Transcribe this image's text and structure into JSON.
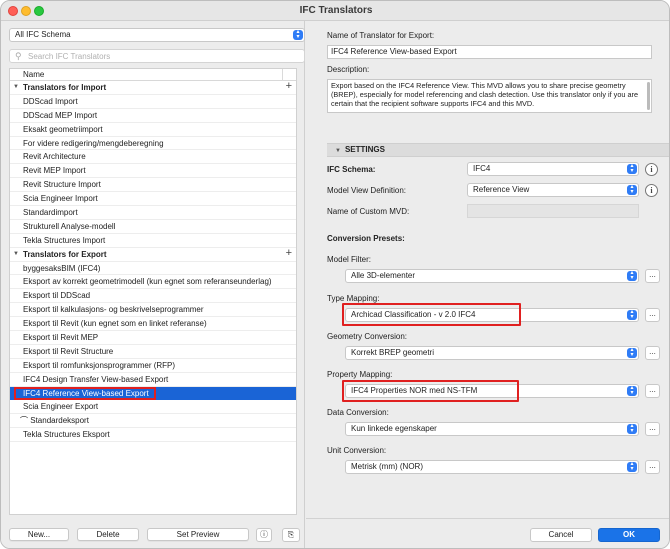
{
  "window": {
    "title": "IFC Translators"
  },
  "left": {
    "schema_select": "All IFC Schema",
    "search_placeholder": "Search IFC Translators",
    "column_header": "Name",
    "import_group": "Translators for Import",
    "import_items": [
      "DDScad Import",
      "DDScad MEP Import",
      "Eksakt geometriimport",
      "For videre redigering/mengdeberegning",
      "Revit Architecture",
      "Revit MEP Import",
      "Revit Structure Import",
      "Scia Engineer Import",
      "Standardimport",
      "Strukturell Analyse-modell",
      "Tekla Structures Import"
    ],
    "export_group": "Translators for Export",
    "export_items": [
      "byggesaksBIM (IFC4)",
      "Eksport av korrekt geometrimodell (kun egnet som referanseunderlag)",
      "Eksport til DDScad",
      "Eksport til kalkulasjons- og beskrivelseprogrammer",
      "Eksport til Revit (kun egnet som en linket referanse)",
      "Eksport til Revit MEP",
      "Eksport til Revit Structure",
      "Eksport til romfunksjonsprogrammer (RFP)",
      "IFC4 Design Transfer View-based Export",
      "IFC4 Reference View-based Export",
      "Scia Engineer Export",
      "Standardeksport",
      "Tekla Structures Eksport"
    ],
    "selected_export": "IFC4 Reference View-based Export",
    "buttons": {
      "new": "New...",
      "delete": "Delete",
      "set_preview": "Set Preview"
    }
  },
  "right": {
    "name_label": "Name of Translator for Export:",
    "name_value": "IFC4 Reference View-based Export",
    "desc_label": "Description:",
    "desc_value": "Export based on the IFC4 Reference View. This MVD allows you to share precise geometry (BREP), especially for model referencing and clash detection. Use this translator only if you are certain that the recipient software supports IFC4 and this MVD.",
    "settings_header": "SETTINGS",
    "ifc_schema_label": "IFC Schema:",
    "ifc_schema_value": "IFC4",
    "mvd_label": "Model View Definition:",
    "mvd_value": "Reference View",
    "custom_mvd_label": "Name of Custom MVD:",
    "presets_header": "Conversion Presets:",
    "model_filter_label": "Model Filter:",
    "model_filter_value": "Alle 3D-elementer",
    "type_mapping_label": "Type Mapping:",
    "type_mapping_value": "Archicad Classification - v 2.0 IFC4",
    "geometry_label": "Geometry Conversion:",
    "geometry_value": "Korrekt BREP geometri",
    "property_label": "Property Mapping:",
    "property_value": "IFC4 Properties NOR med NS-TFM",
    "data_label": "Data Conversion:",
    "data_value": "Kun linkede egenskaper",
    "unit_label": "Unit Conversion:",
    "unit_value": "Metrisk (mm) (NOR)",
    "cancel": "Cancel",
    "ok": "OK",
    "more": "..."
  }
}
